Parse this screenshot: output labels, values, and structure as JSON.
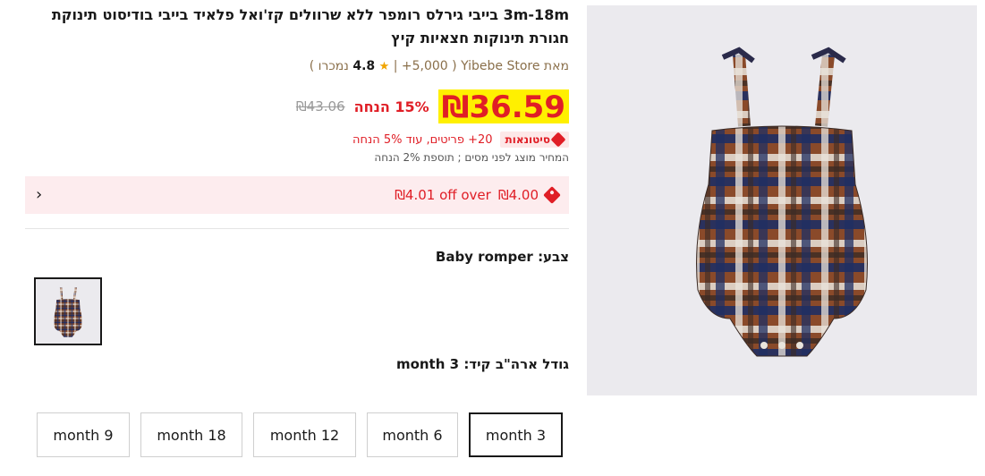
{
  "product": {
    "title": "3m-18m בייבי גירלס רומפר ללא שרוולים קז'ואל פלאיד בייבי בודיסוט תינוקת חגורת תינוקות חצאיות קיץ",
    "store_prefix": "מאת",
    "store_name": "Yibebe Store",
    "rating": "4.8",
    "sold": "+5,000 נמכרו"
  },
  "price": {
    "current": "₪36.59",
    "discount": "15% הנחה",
    "original": "₪43.06"
  },
  "promo": {
    "bulk_badge": "סיטונאות",
    "bulk_text": "20+ פריטים, עוד 5% הנחה",
    "tax_note": "המחיר מוצג לפני מסים ; תוספת 2% הנחה"
  },
  "coupon": {
    "amount": "₪4.00",
    "threshold": "₪4.01 off over"
  },
  "color": {
    "label": "צבע:",
    "value": "Baby romper"
  },
  "size": {
    "label": "גודל ארה\"ב קיד:",
    "value": "3 month",
    "options": [
      "month 9",
      "month 18",
      "month 12",
      "month 6",
      "month 3"
    ]
  },
  "colors": {
    "accent": "#e01e26",
    "price_bg": "#fff000",
    "coupon_bg": "#fdecee"
  }
}
